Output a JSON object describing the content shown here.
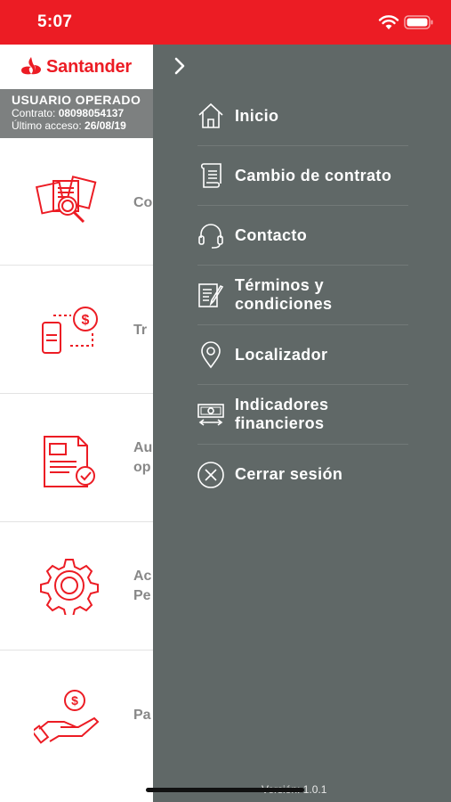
{
  "status_bar": {
    "time": "5:07",
    "icons": [
      "wifi-icon",
      "battery-icon"
    ]
  },
  "header": {
    "brand": "Santander",
    "brand_color": "#ec1c24"
  },
  "user_banner": {
    "name": "USUARIO OPERADO",
    "contract_label": "Contrato:",
    "contract_value": "08098054137",
    "access_label": "Último acceso:",
    "access_value": "26/08/19"
  },
  "background_list": [
    {
      "icon": "documents-search-icon",
      "label": "Co"
    },
    {
      "icon": "mobile-transfer-icon",
      "label": "Tr"
    },
    {
      "icon": "document-check-icon",
      "label": "Au\nop"
    },
    {
      "icon": "settings-gear-icon",
      "label": "Ac\nPe"
    },
    {
      "icon": "hand-money-icon",
      "label": "Pa"
    }
  ],
  "drawer": {
    "background": "#606867",
    "items": [
      {
        "icon": "home-icon",
        "label": "Inicio"
      },
      {
        "icon": "contract-scroll-icon",
        "label": "Cambio de contrato"
      },
      {
        "icon": "headset-icon",
        "label": "Contacto"
      },
      {
        "icon": "terms-document-icon",
        "label": "Términos y\ncondiciones"
      },
      {
        "icon": "location-pin-icon",
        "label": "Localizador"
      },
      {
        "icon": "financial-indicators-icon",
        "label": "Indicadores\nfinancieros"
      },
      {
        "icon": "close-circle-icon",
        "label": "Cerrar sesión"
      }
    ],
    "version": "Versión: 1.0.1"
  }
}
